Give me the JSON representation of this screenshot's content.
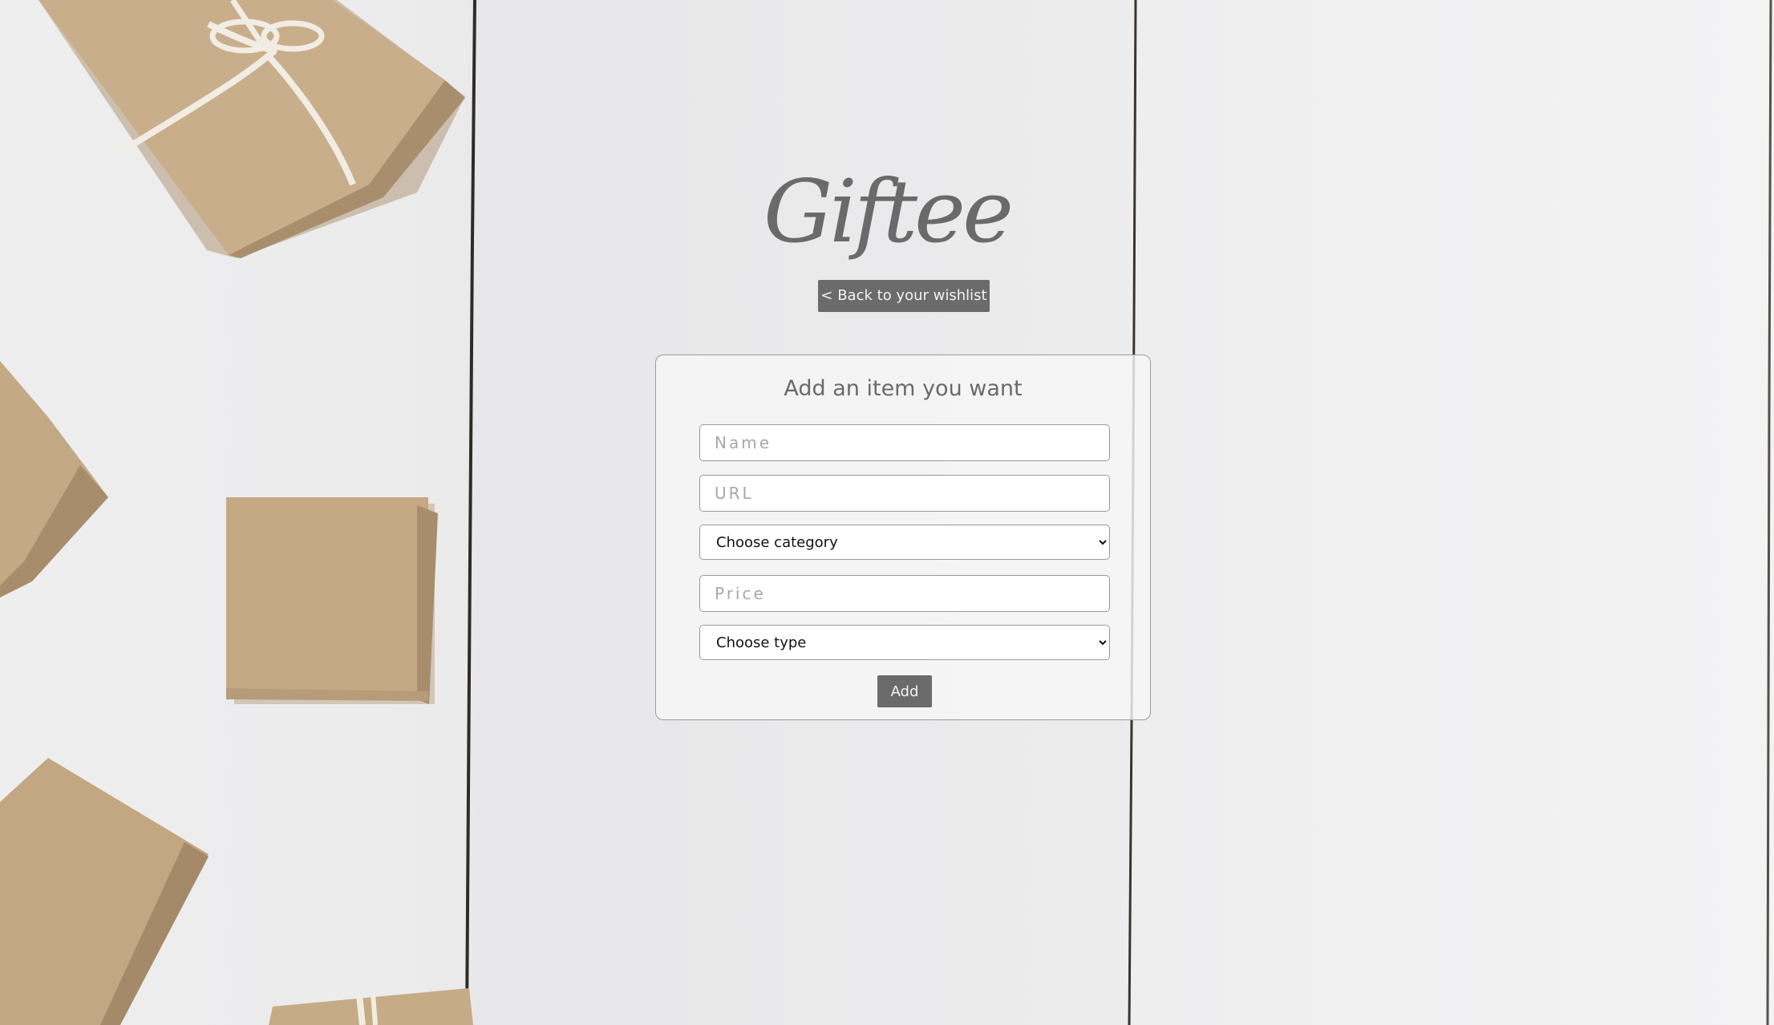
{
  "app": {
    "logo_text": "Giftee"
  },
  "nav": {
    "back_label": "< Back to your wishlist"
  },
  "form": {
    "title": "Add an item you want",
    "name_placeholder": "Name",
    "url_placeholder": "URL",
    "category_selected": "Choose category",
    "price_placeholder": "Price",
    "type_selected": "Choose type",
    "submit_label": "Add"
  },
  "icons": {
    "select_arrow": "chevron-down-icon"
  },
  "colors": {
    "button_bg": "#6b6b6b",
    "button_text": "#f2f2f2",
    "logo_text": "#6a6a6a",
    "card_border": "#9c9c9c",
    "box_kraft": "#c8ae8c"
  }
}
